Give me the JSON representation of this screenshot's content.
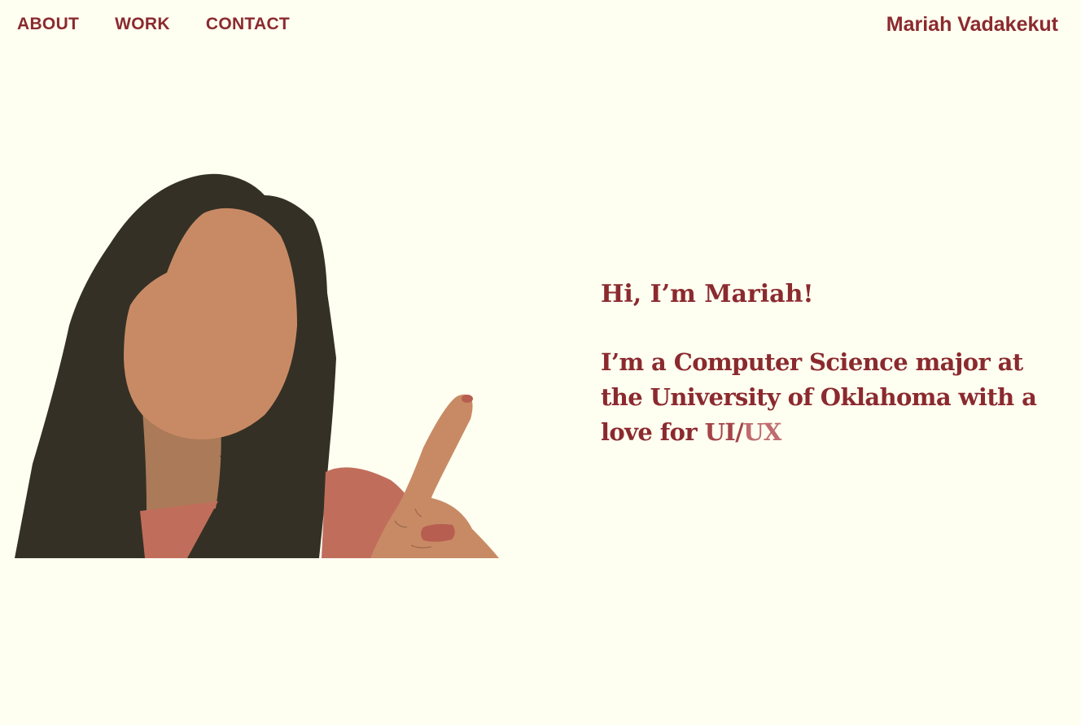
{
  "nav": {
    "items": [
      {
        "label": "ABOUT"
      },
      {
        "label": "WORK"
      },
      {
        "label": "CONTACT"
      }
    ]
  },
  "brand": {
    "name": "Mariah Vadakekut"
  },
  "hero": {
    "greeting": "Hi, I’m Mariah!",
    "bio_text": "I’m a Computer Science major at the University of Oklahoma with a love for ",
    "highlight_ui": "UI",
    "highlight_sep": "/",
    "highlight_ux": "UX",
    "illustration_icon": "woman-pointing-up-illustration"
  },
  "colors": {
    "background": "#FEFEF1",
    "accent": "#8B2A2E",
    "hair": "#343025",
    "skin": "#C88A65",
    "shirt": "#C06E5B"
  }
}
